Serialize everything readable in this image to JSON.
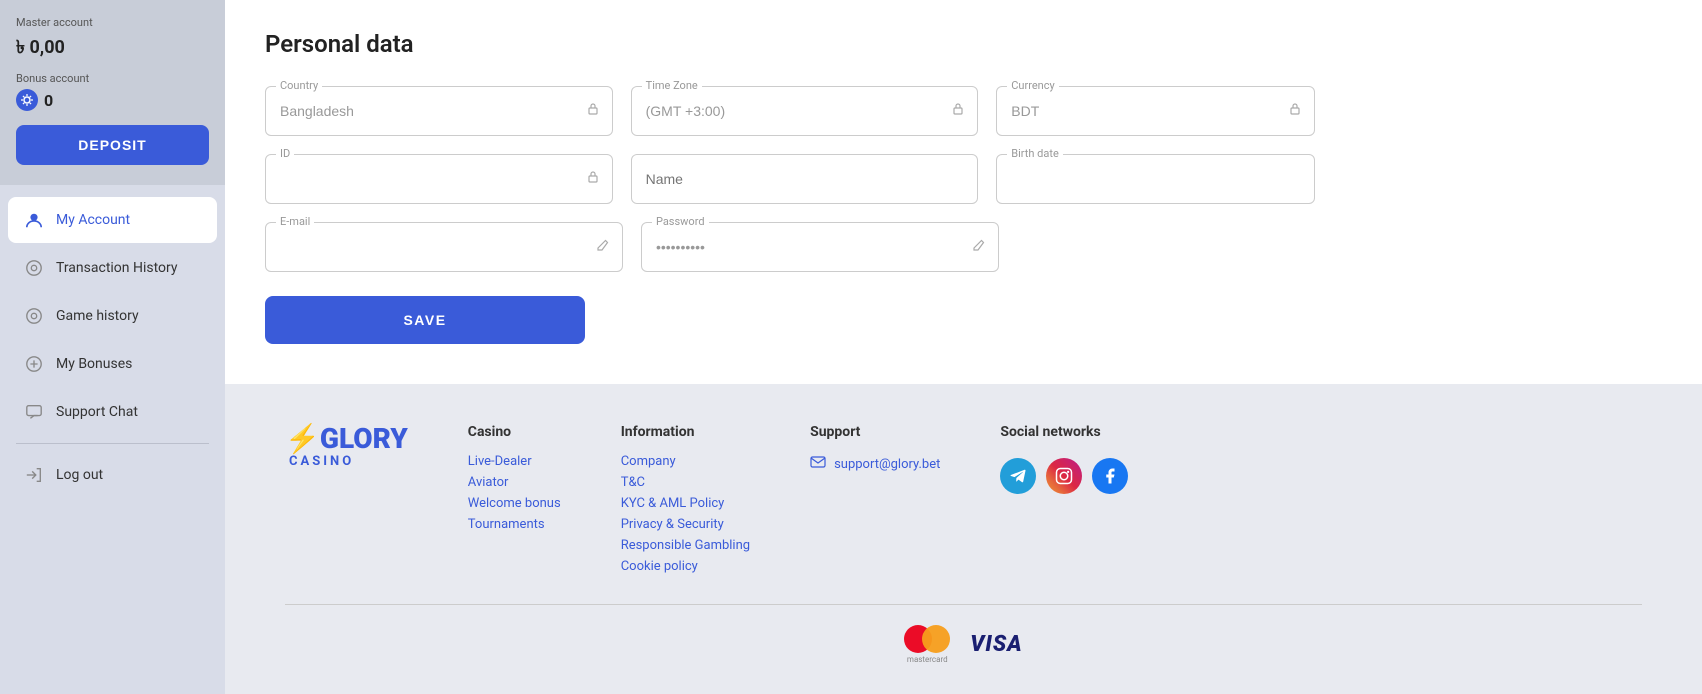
{
  "sidebar": {
    "master_account_label": "Master account",
    "master_balance": "৳ 0,00",
    "bonus_account_label": "Bonus account",
    "bonus_amount": "0",
    "deposit_button": "DEPOSIT",
    "nav_items": [
      {
        "id": "my-account",
        "label": "My Account",
        "active": true
      },
      {
        "id": "transaction-history",
        "label": "Transaction History",
        "active": false
      },
      {
        "id": "game-history",
        "label": "Game history",
        "active": false
      },
      {
        "id": "my-bonuses",
        "label": "My Bonuses",
        "active": false
      },
      {
        "id": "support-chat",
        "label": "Support Chat",
        "active": false
      }
    ],
    "logout_label": "Log out"
  },
  "personal_data": {
    "title": "Personal data",
    "fields": {
      "country_label": "Country",
      "country_value": "Bangladesh",
      "timezone_label": "Time Zone",
      "timezone_value": "(GMT +3:00)",
      "currency_label": "Currency",
      "currency_value": "BDT",
      "id_label": "ID",
      "id_value": "",
      "name_label": "Name",
      "name_placeholder": "Name",
      "birthdate_label": "Birth date",
      "birthdate_value": "",
      "email_label": "E-mail",
      "email_value": "",
      "password_label": "Password",
      "password_value": "••••••••••"
    },
    "save_button": "SAVE"
  },
  "footer": {
    "logo_top": "GLORY",
    "logo_bottom": "CASINO",
    "casino_col": {
      "title": "Casino",
      "links": [
        "Live-Dealer",
        "Aviator",
        "Welcome bonus",
        "Tournaments"
      ]
    },
    "information_col": {
      "title": "Information",
      "links": [
        "Company",
        "T&C",
        "KYC & AML Policy",
        "Privacy & Security",
        "Responsible Gambling",
        "Cookie policy"
      ]
    },
    "support_col": {
      "title": "Support",
      "email": "support@glory.bet"
    },
    "social_col": {
      "title": "Social networks"
    }
  }
}
